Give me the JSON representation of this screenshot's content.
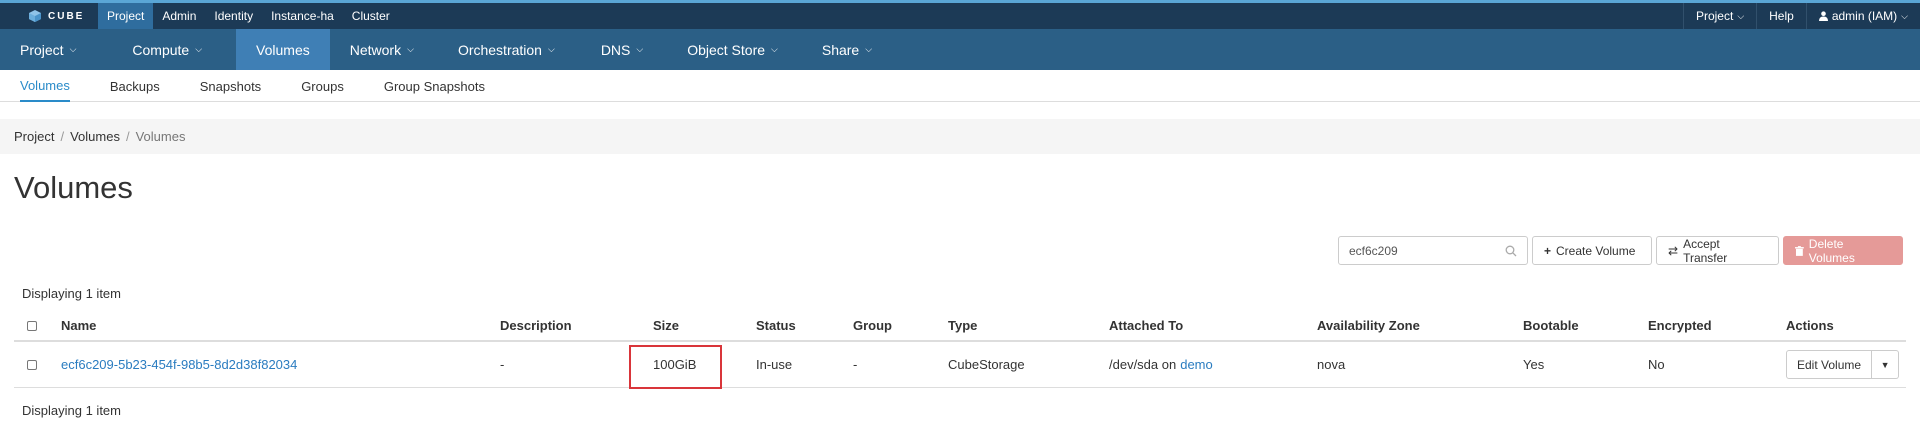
{
  "brand": {
    "name": "CUBE",
    "icon": "cube-icon"
  },
  "topnav": {
    "items": [
      "Project",
      "Admin",
      "Identity",
      "Instance-ha",
      "Cluster"
    ],
    "right": {
      "project": "Project",
      "help": "Help",
      "user": "admin (IAM)"
    }
  },
  "mainnav": {
    "items": [
      "Project",
      "Compute",
      "Volumes",
      "Network",
      "Orchestration",
      "DNS",
      "Object Store",
      "Share"
    ]
  },
  "subnav": {
    "items": [
      "Volumes",
      "Backups",
      "Snapshots",
      "Groups",
      "Group Snapshots"
    ]
  },
  "breadcrumb": {
    "items": [
      "Project",
      "Volumes",
      "Volumes"
    ],
    "separator": "/"
  },
  "page": {
    "title": "Volumes"
  },
  "toolbar": {
    "search_value": "ecf6c209",
    "create_label": "Create Volume",
    "accept_label": "Accept Transfer",
    "delete_label": "Delete Volumes"
  },
  "table": {
    "displaying": "Displaying 1 item",
    "headers": [
      "Name",
      "Description",
      "Size",
      "Status",
      "Group",
      "Type",
      "Attached To",
      "Availability Zone",
      "Bootable",
      "Encrypted",
      "Actions"
    ],
    "rows": [
      {
        "name": "ecf6c209-5b23-454f-98b5-8d2d38f82034",
        "description": "-",
        "size": "100GiB",
        "status": "In-use",
        "group": "-",
        "type": "CubeStorage",
        "attached_prefix": "/dev/sda on",
        "attached_link": "demo",
        "zone": "nova",
        "bootable": "Yes",
        "encrypted": "No",
        "action": "Edit Volume"
      }
    ]
  },
  "colors": {
    "accent": "#2a8bc9",
    "highlight": "#d9353a",
    "danger": "#e59a98"
  }
}
